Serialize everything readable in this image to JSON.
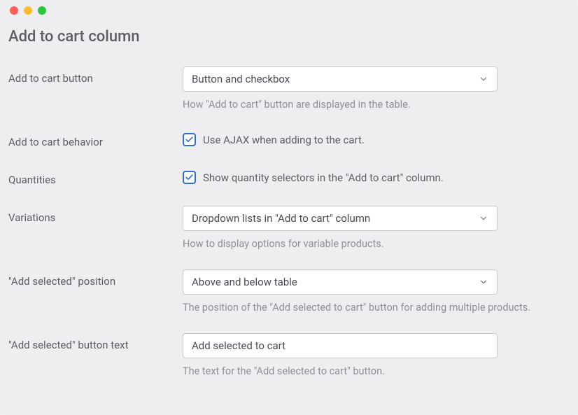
{
  "section": {
    "title": "Add to cart column"
  },
  "fields": {
    "button": {
      "label": "Add to cart button",
      "value": "Button and checkbox",
      "help": "How \"Add to cart\" button are displayed in the table."
    },
    "behavior": {
      "label": "Add to cart behavior",
      "checkbox_label": "Use AJAX when adding to the cart."
    },
    "quantities": {
      "label": "Quantities",
      "checkbox_label": "Show quantity selectors in the \"Add to cart\" column."
    },
    "variations": {
      "label": "Variations",
      "value": "Dropdown lists in \"Add to cart\" column",
      "help": "How to display options for variable products."
    },
    "position": {
      "label": "\"Add selected\" position",
      "value": "Above and below table",
      "help": "The position of the \"Add selected to cart\" button for adding multiple products."
    },
    "button_text": {
      "label": "\"Add selected\" button text",
      "value": "Add selected to cart",
      "help": "The text for the \"Add selected to cart\" button."
    }
  }
}
